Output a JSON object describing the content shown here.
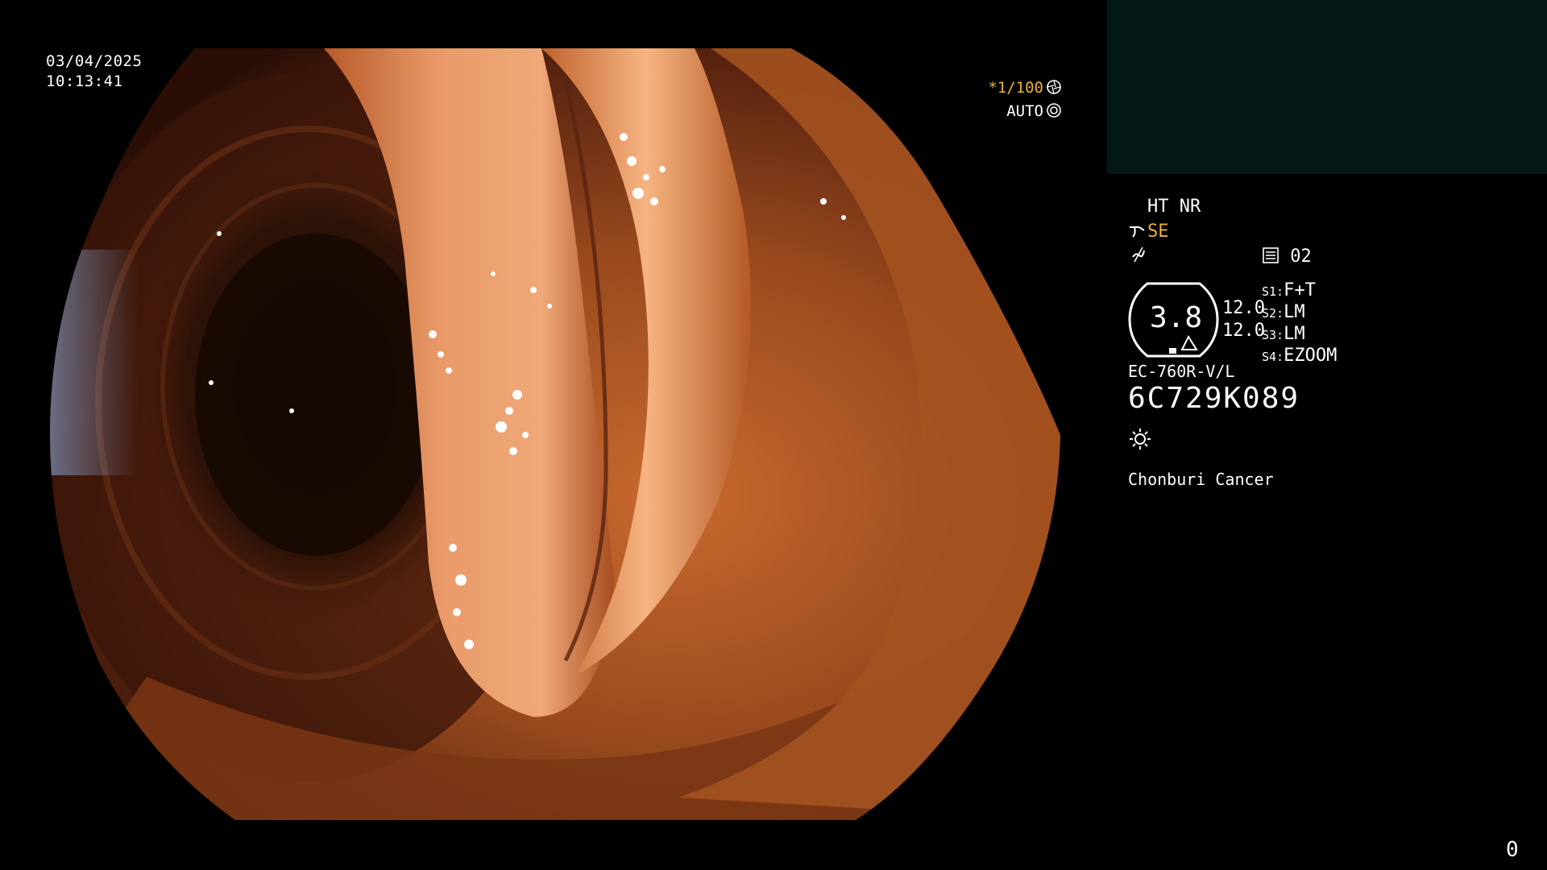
{
  "overlay": {
    "date": "03/04/2025",
    "time": "10:13:41",
    "shutter": "*1/100",
    "exposure_mode": "AUTO",
    "corner_counter": "0"
  },
  "info_panel": {
    "line1": "HT NR",
    "mode": "SE",
    "channel": "02",
    "gauge_value": "3.8",
    "gauge_right_1": "12.0",
    "gauge_right_2": "12.0",
    "switches": [
      {
        "key": "S1:",
        "value": "F+T"
      },
      {
        "key": "S2:",
        "value": "LM"
      },
      {
        "key": "S3:",
        "value": "LM"
      },
      {
        "key": "S4:",
        "value": "EZOOM"
      }
    ],
    "scope_model": "EC-760R-V/L",
    "serial": "6C729K089",
    "facility": "Chonburi Cancer"
  },
  "colors": {
    "accent_yellow": "#f0b030",
    "panel_teal": "#031816",
    "mucosa_orange": "#c8642a"
  },
  "icons": [
    "aperture-icon",
    "target-icon",
    "scope-icon",
    "flat-icon",
    "keypad-icon",
    "light-icon"
  ]
}
